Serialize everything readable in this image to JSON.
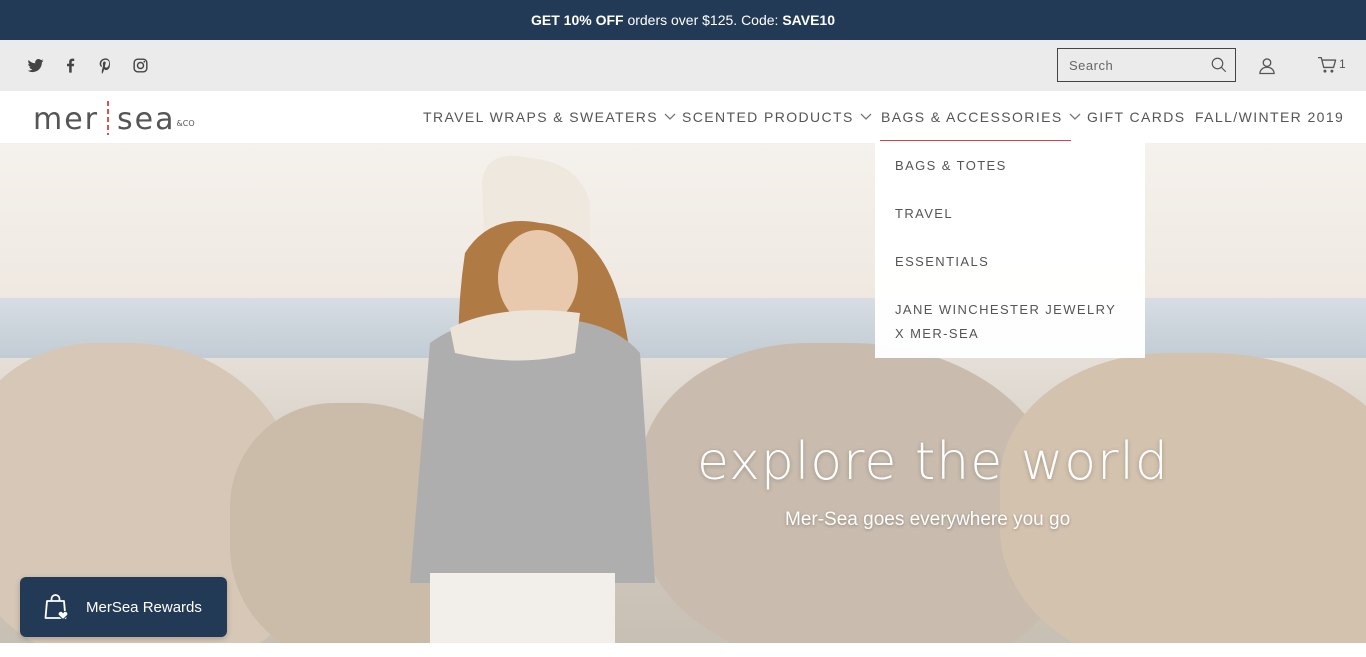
{
  "promo": {
    "prefix": "GET 10% OFF",
    "middle": " orders over $125. Code: ",
    "code": "SAVE10"
  },
  "utility": {
    "social": [
      "twitter-icon",
      "facebook-icon",
      "pinterest-icon",
      "instagram-icon"
    ],
    "search_placeholder": "Search",
    "cart_count": "1"
  },
  "logo": {
    "left": "mer",
    "right": "sea",
    "suffix": "&CO"
  },
  "nav": {
    "items": [
      {
        "label": "TRAVEL WRAPS & SWEATERS",
        "has_dropdown": true
      },
      {
        "label": "SCENTED PRODUCTS",
        "has_dropdown": true
      },
      {
        "label": "BAGS & ACCESSORIES",
        "has_dropdown": true,
        "active": true
      },
      {
        "label": "GIFT CARDS",
        "has_dropdown": false
      },
      {
        "label": "FALL/WINTER 2019",
        "has_dropdown": false
      }
    ]
  },
  "dropdown": {
    "items": [
      "BAGS & TOTES",
      "TRAVEL",
      "ESSENTIALS",
      "JANE WINCHESTER JEWELRY",
      "X MER-SEA"
    ]
  },
  "hero": {
    "title": "explore the world",
    "subtitle": "Mer-Sea goes everywhere you go"
  },
  "rewards": {
    "label": "MerSea Rewards"
  },
  "colors": {
    "navy": "#233a56",
    "accent": "#c9474b",
    "utility_bg": "#ebebeb"
  }
}
